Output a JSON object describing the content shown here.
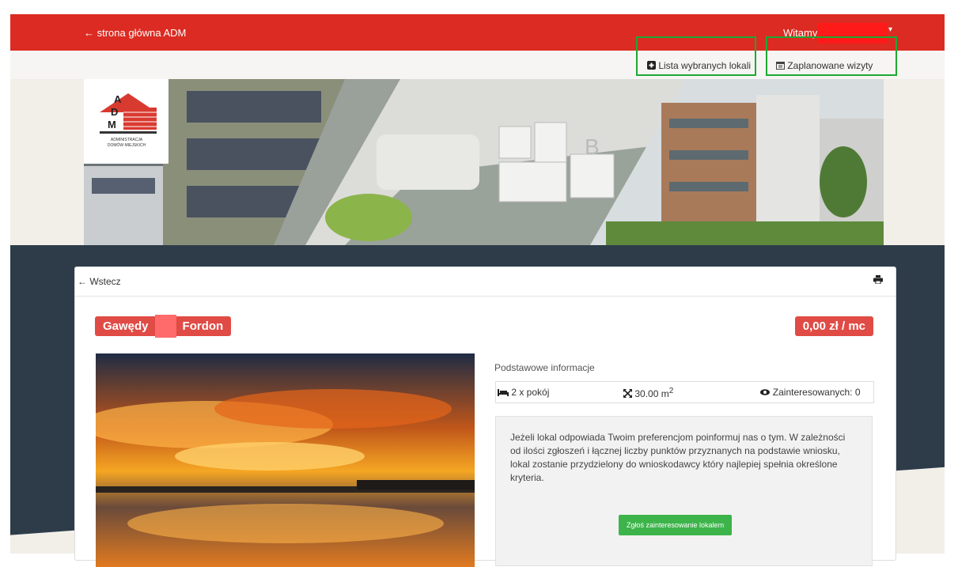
{
  "topbar": {
    "home_link": "← strona główna ADM",
    "welcome": "Witamy,",
    "caret": "▾"
  },
  "subbar": {
    "selected_list": "Lista wybranych lokali",
    "planned_visits": "Zaplanowane wizyty"
  },
  "logo": {
    "letters": [
      "A",
      "D",
      "M"
    ],
    "line1": "ADMINISTRACJA",
    "line2": "DOMÓW MIEJSKICH"
  },
  "card": {
    "back": "← Wstecz",
    "address_part1": "Gawędy",
    "address_part2": "Fordon",
    "price": "0,00 zł / mc",
    "info_title": "Podstawowe informacje",
    "rooms": "2 x pokój",
    "area": "30.00 m",
    "area_sup": "2",
    "interested": "Zainteresowanych: 0",
    "notice": "Jeżeli lokal odpowiada Twoim preferencjom poinformuj nas o tym. W zależności od ilości zgłoszeń i łącznej liczby punktów przyznanych na podstawie wniosku, lokal zostanie przydzielony do wnioskodawcy który najlepiej spełnia określone kryteria.",
    "cta": "Zgłoś zainteresowanie lokalem"
  },
  "colors": {
    "brand_red": "#db2b22",
    "badge_red": "#e04b45",
    "cta_green": "#3cb44a",
    "highlight_green": "#1ea832",
    "dark": "#2e3c4a"
  }
}
